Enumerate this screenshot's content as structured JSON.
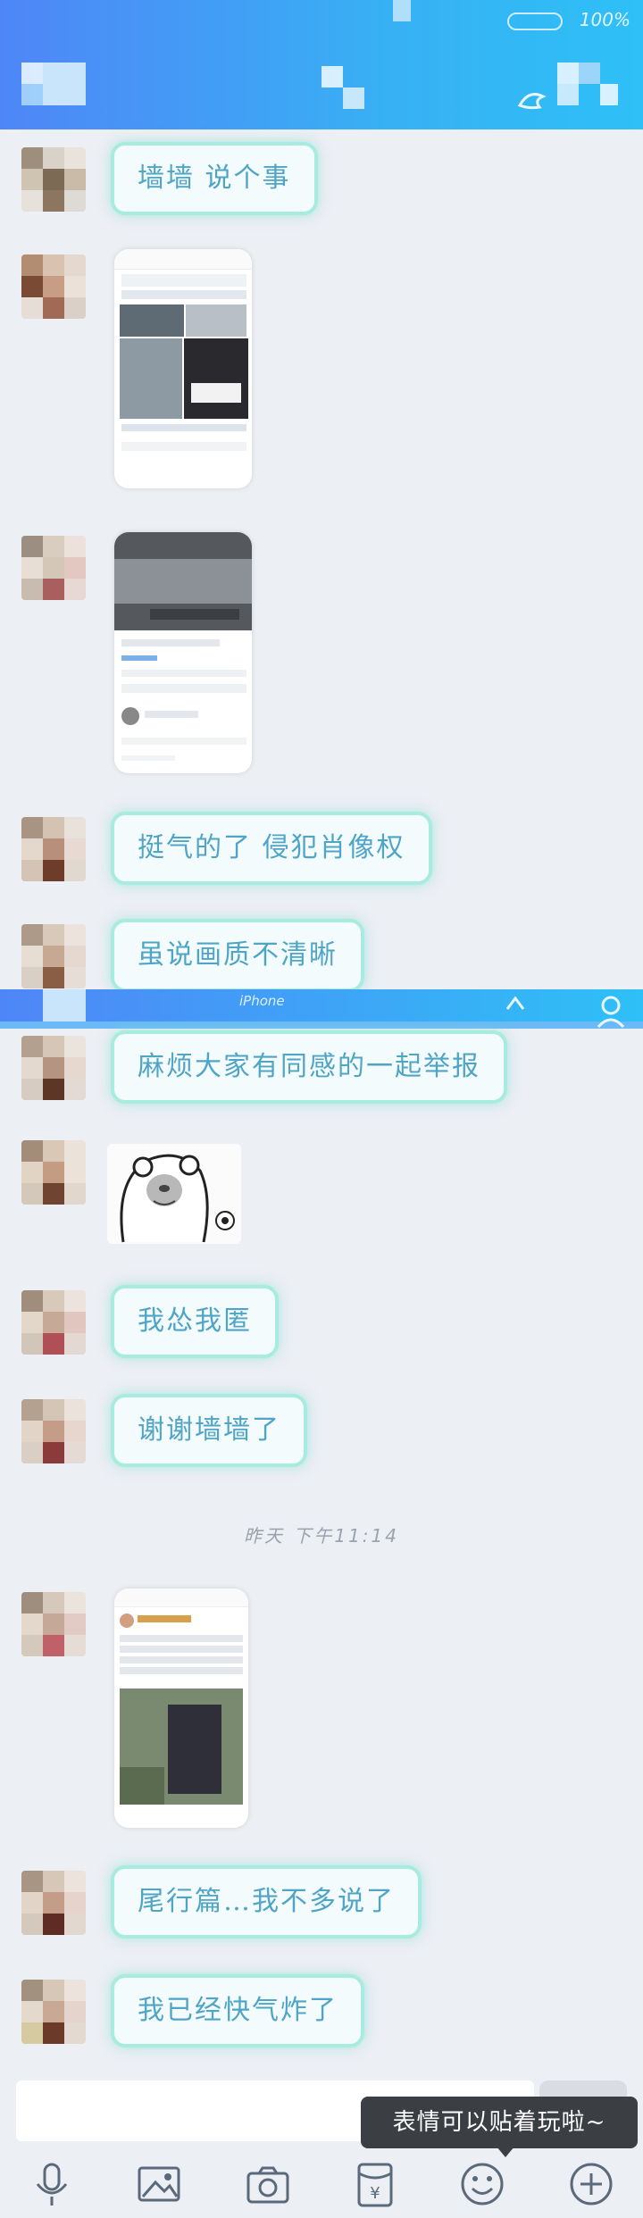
{
  "status": {
    "battery": "100%"
  },
  "messages": [
    {
      "id": "m1",
      "type": "text",
      "text": "墙墙 说个事"
    },
    {
      "id": "m2",
      "type": "image"
    },
    {
      "id": "m3",
      "type": "image"
    },
    {
      "id": "m4",
      "type": "text",
      "text": "挺气的了 侵犯肖像权"
    },
    {
      "id": "m5",
      "type": "text",
      "text": "虽说画质不清晰"
    },
    {
      "id": "m6",
      "type": "text",
      "text": "麻烦大家有同感的一起举报"
    },
    {
      "id": "m7",
      "type": "sticker"
    },
    {
      "id": "m8",
      "type": "text",
      "text": "我怂我匿"
    },
    {
      "id": "m9",
      "type": "text",
      "text": "谢谢墙墙了"
    },
    {
      "id": "m10",
      "type": "image"
    },
    {
      "id": "m11",
      "type": "text",
      "text": "尾行篇…我不多说了"
    },
    {
      "id": "m12",
      "type": "text",
      "text": "我已经快气炸了"
    }
  ],
  "timestamp": "昨天 下午11:14",
  "midbar": {
    "text": "iPhone"
  },
  "tooltip": "表情可以贴着玩啦~",
  "toolbar": {
    "icons": [
      "microphone-icon",
      "image-icon",
      "camera-icon",
      "red-packet-icon",
      "emoji-icon",
      "plus-icon"
    ]
  },
  "colors": {
    "header": "#4f86f7",
    "bubble_border": "#a8ecdf",
    "bubble_text": "#4fa5c6",
    "background": "#eceff4"
  }
}
